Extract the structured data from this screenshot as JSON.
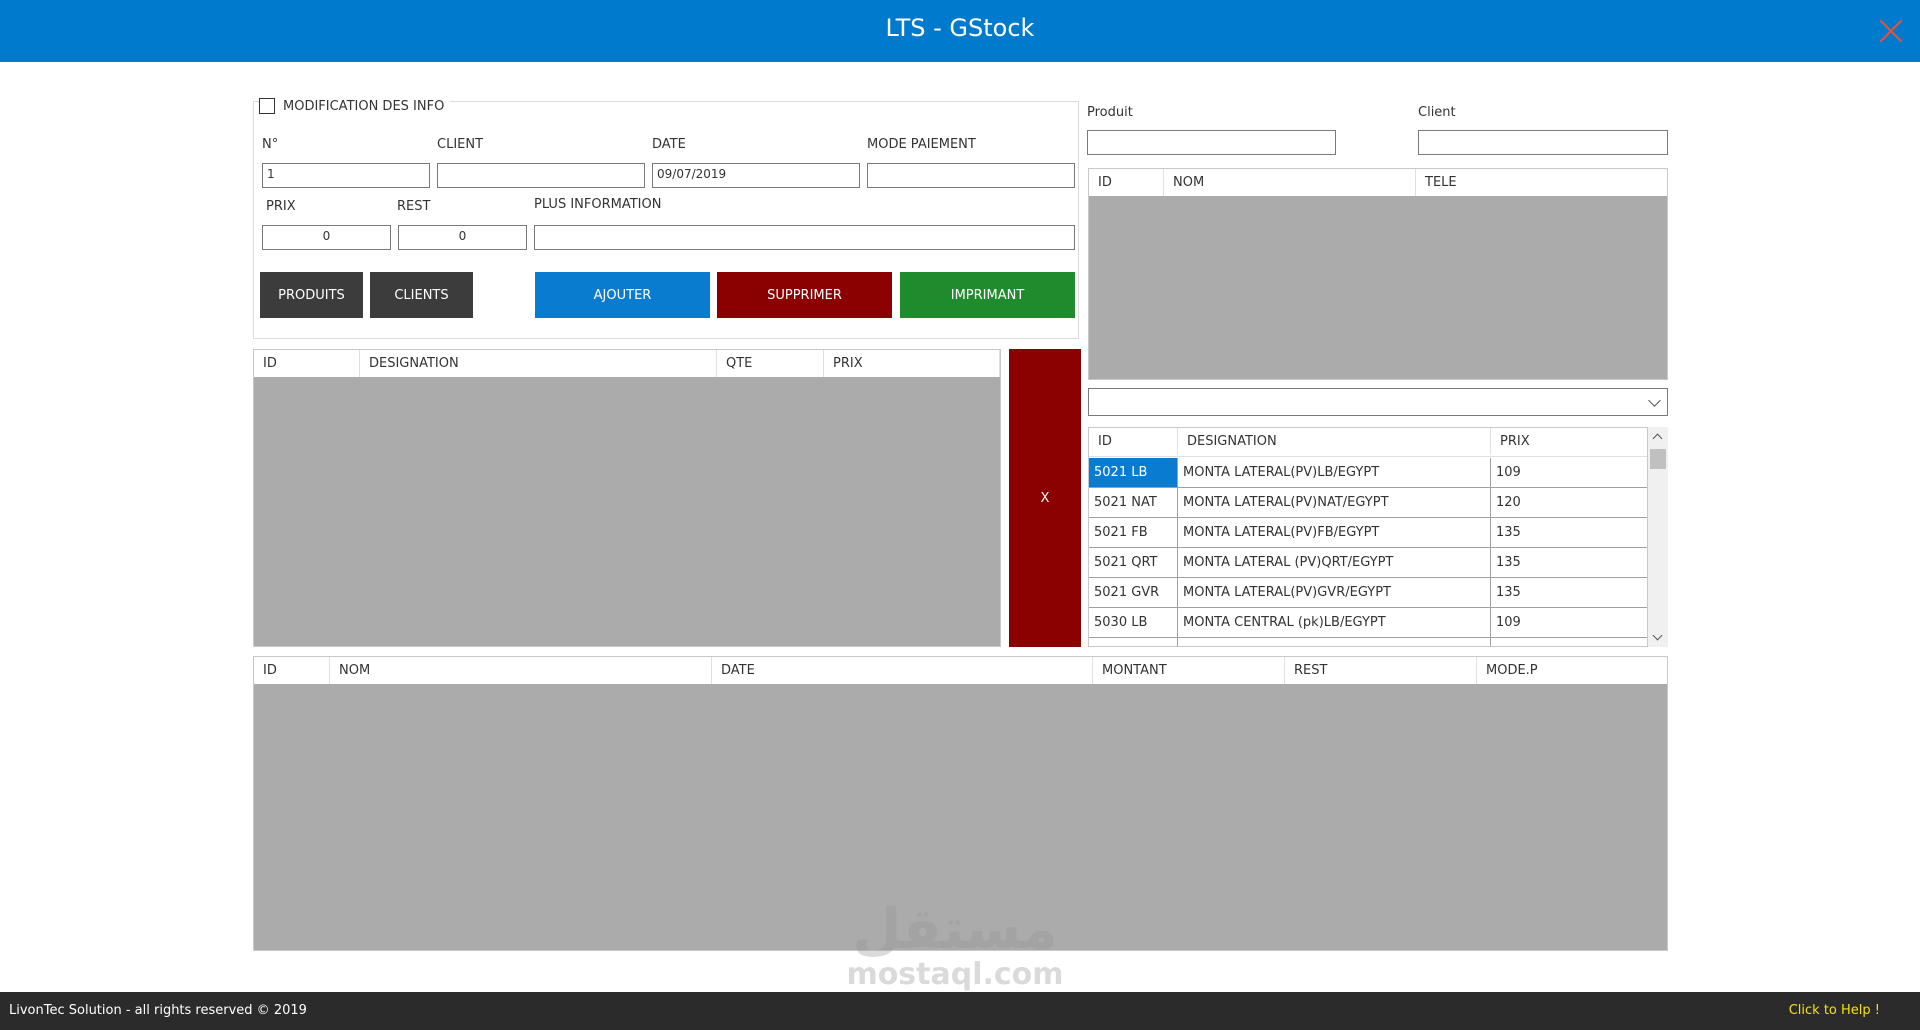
{
  "window": {
    "title": "LTS - GStock"
  },
  "form": {
    "checkbox_label": "MODIFICATION DES INFO",
    "labels": {
      "numero": "N°",
      "client": "CLIENT",
      "date": "DATE",
      "mode_paiement": "MODE PAIEMENT",
      "prix": "PRIX",
      "rest": "REST",
      "plus_information": "PLUS INFORMATION"
    },
    "values": {
      "numero": "1",
      "client": "",
      "date": "09/07/2019",
      "mode_paiement": "",
      "prix": "0",
      "rest": "0",
      "plus_information": ""
    },
    "buttons": {
      "produits": "PRODUITS",
      "clients": "CLIENTS",
      "ajouter": "AJOUTER",
      "supprimer": "SUPPRIMER",
      "imprimant": "IMPRIMANT"
    }
  },
  "cart_grid": {
    "columns": [
      "ID",
      "DESIGNATION",
      "QTE",
      "PRIX"
    ]
  },
  "remove_button": "X",
  "search": {
    "produit_label": "Produit",
    "client_label": "Client",
    "produit_value": "",
    "client_value": ""
  },
  "client_grid": {
    "columns": [
      "ID",
      "NOM",
      "TELE"
    ]
  },
  "product_combo": {
    "value": ""
  },
  "product_grid": {
    "columns": [
      "ID",
      "DESIGNATION",
      "PRIX"
    ],
    "rows": [
      {
        "id": "5021 LB",
        "designation": "MONTA LATERAL(PV)LB/EGYPT",
        "prix": "109"
      },
      {
        "id": "5021 NAT",
        "designation": "MONTA LATERAL(PV)NAT/EGYPT",
        "prix": "120"
      },
      {
        "id": "5021 FB",
        "designation": "MONTA LATERAL(PV)FB/EGYPT",
        "prix": "135"
      },
      {
        "id": "5021 QRT",
        "designation": "MONTA LATERAL (PV)QRT/EGYPT",
        "prix": "135"
      },
      {
        "id": "5021 GVR",
        "designation": "MONTA LATERAL(PV)GVR/EGYPT",
        "prix": "135"
      },
      {
        "id": "5030 LB",
        "designation": "MONTA CENTRAL (pk)LB/EGYPT",
        "prix": "109"
      }
    ]
  },
  "sales_grid": {
    "columns": [
      "ID",
      "NOM",
      "DATE",
      "MONTANT",
      "REST",
      "MODE.P"
    ]
  },
  "footer": {
    "copyright": "LivonTec Solution - all rights reserved © 2019",
    "help": "Click to Help !"
  },
  "watermark": {
    "arabic": "مستقل",
    "latin": "mostaql.com"
  },
  "colors": {
    "titlebar": "#007acc",
    "ajouter": "#0a7cd0",
    "supprimer": "#8b0000",
    "imprimant": "#1f8b2c",
    "dark_button": "#3c3c3c",
    "grid_empty": "#ababab",
    "footer": "#2b2b2b",
    "help_text": "#f5e300"
  }
}
